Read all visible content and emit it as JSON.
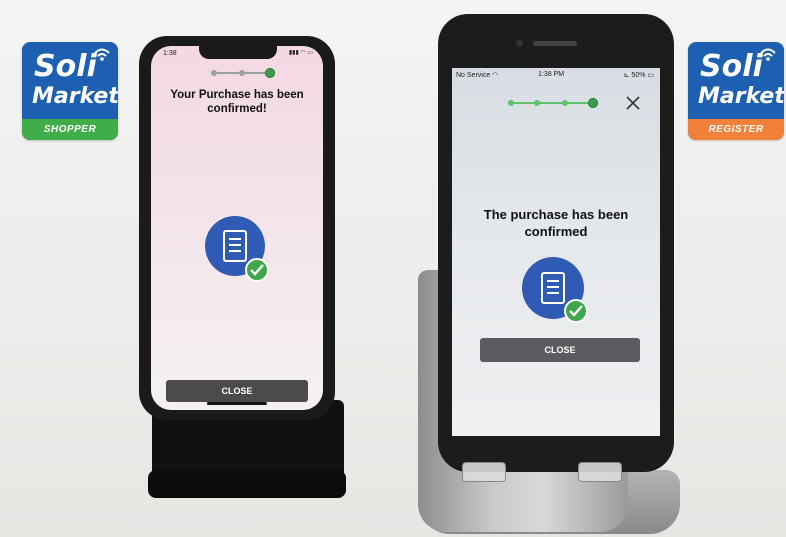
{
  "logos": {
    "left": {
      "line1": "Soli",
      "line2": "Market",
      "band": "SHOPPER",
      "band_color": "#3fae49",
      "icon": "wifi-icon"
    },
    "right": {
      "line1": "Soli",
      "line2": "Market",
      "band": "REGISTER",
      "band_color": "#f0803a",
      "icon": "wifi-icon"
    }
  },
  "shopper_phone": {
    "status_time": "1:38",
    "steps": {
      "total": 3,
      "active": 3
    },
    "title": "Your Purchase has been confirmed!",
    "icon": "document-check-icon",
    "button": "CLOSE"
  },
  "register_phone": {
    "status_left": "No Service",
    "status_time": "1:38 PM",
    "status_right": "50%",
    "steps": {
      "total": 4,
      "active": 4
    },
    "close_icon": "close-icon",
    "title": "The purchase has been confirmed",
    "icon": "document-check-icon",
    "button": "CLOSE"
  },
  "colors": {
    "brand_blue": "#1d5fb0",
    "success_green": "#3fa64a",
    "button_gray": "#4b4b4b"
  }
}
